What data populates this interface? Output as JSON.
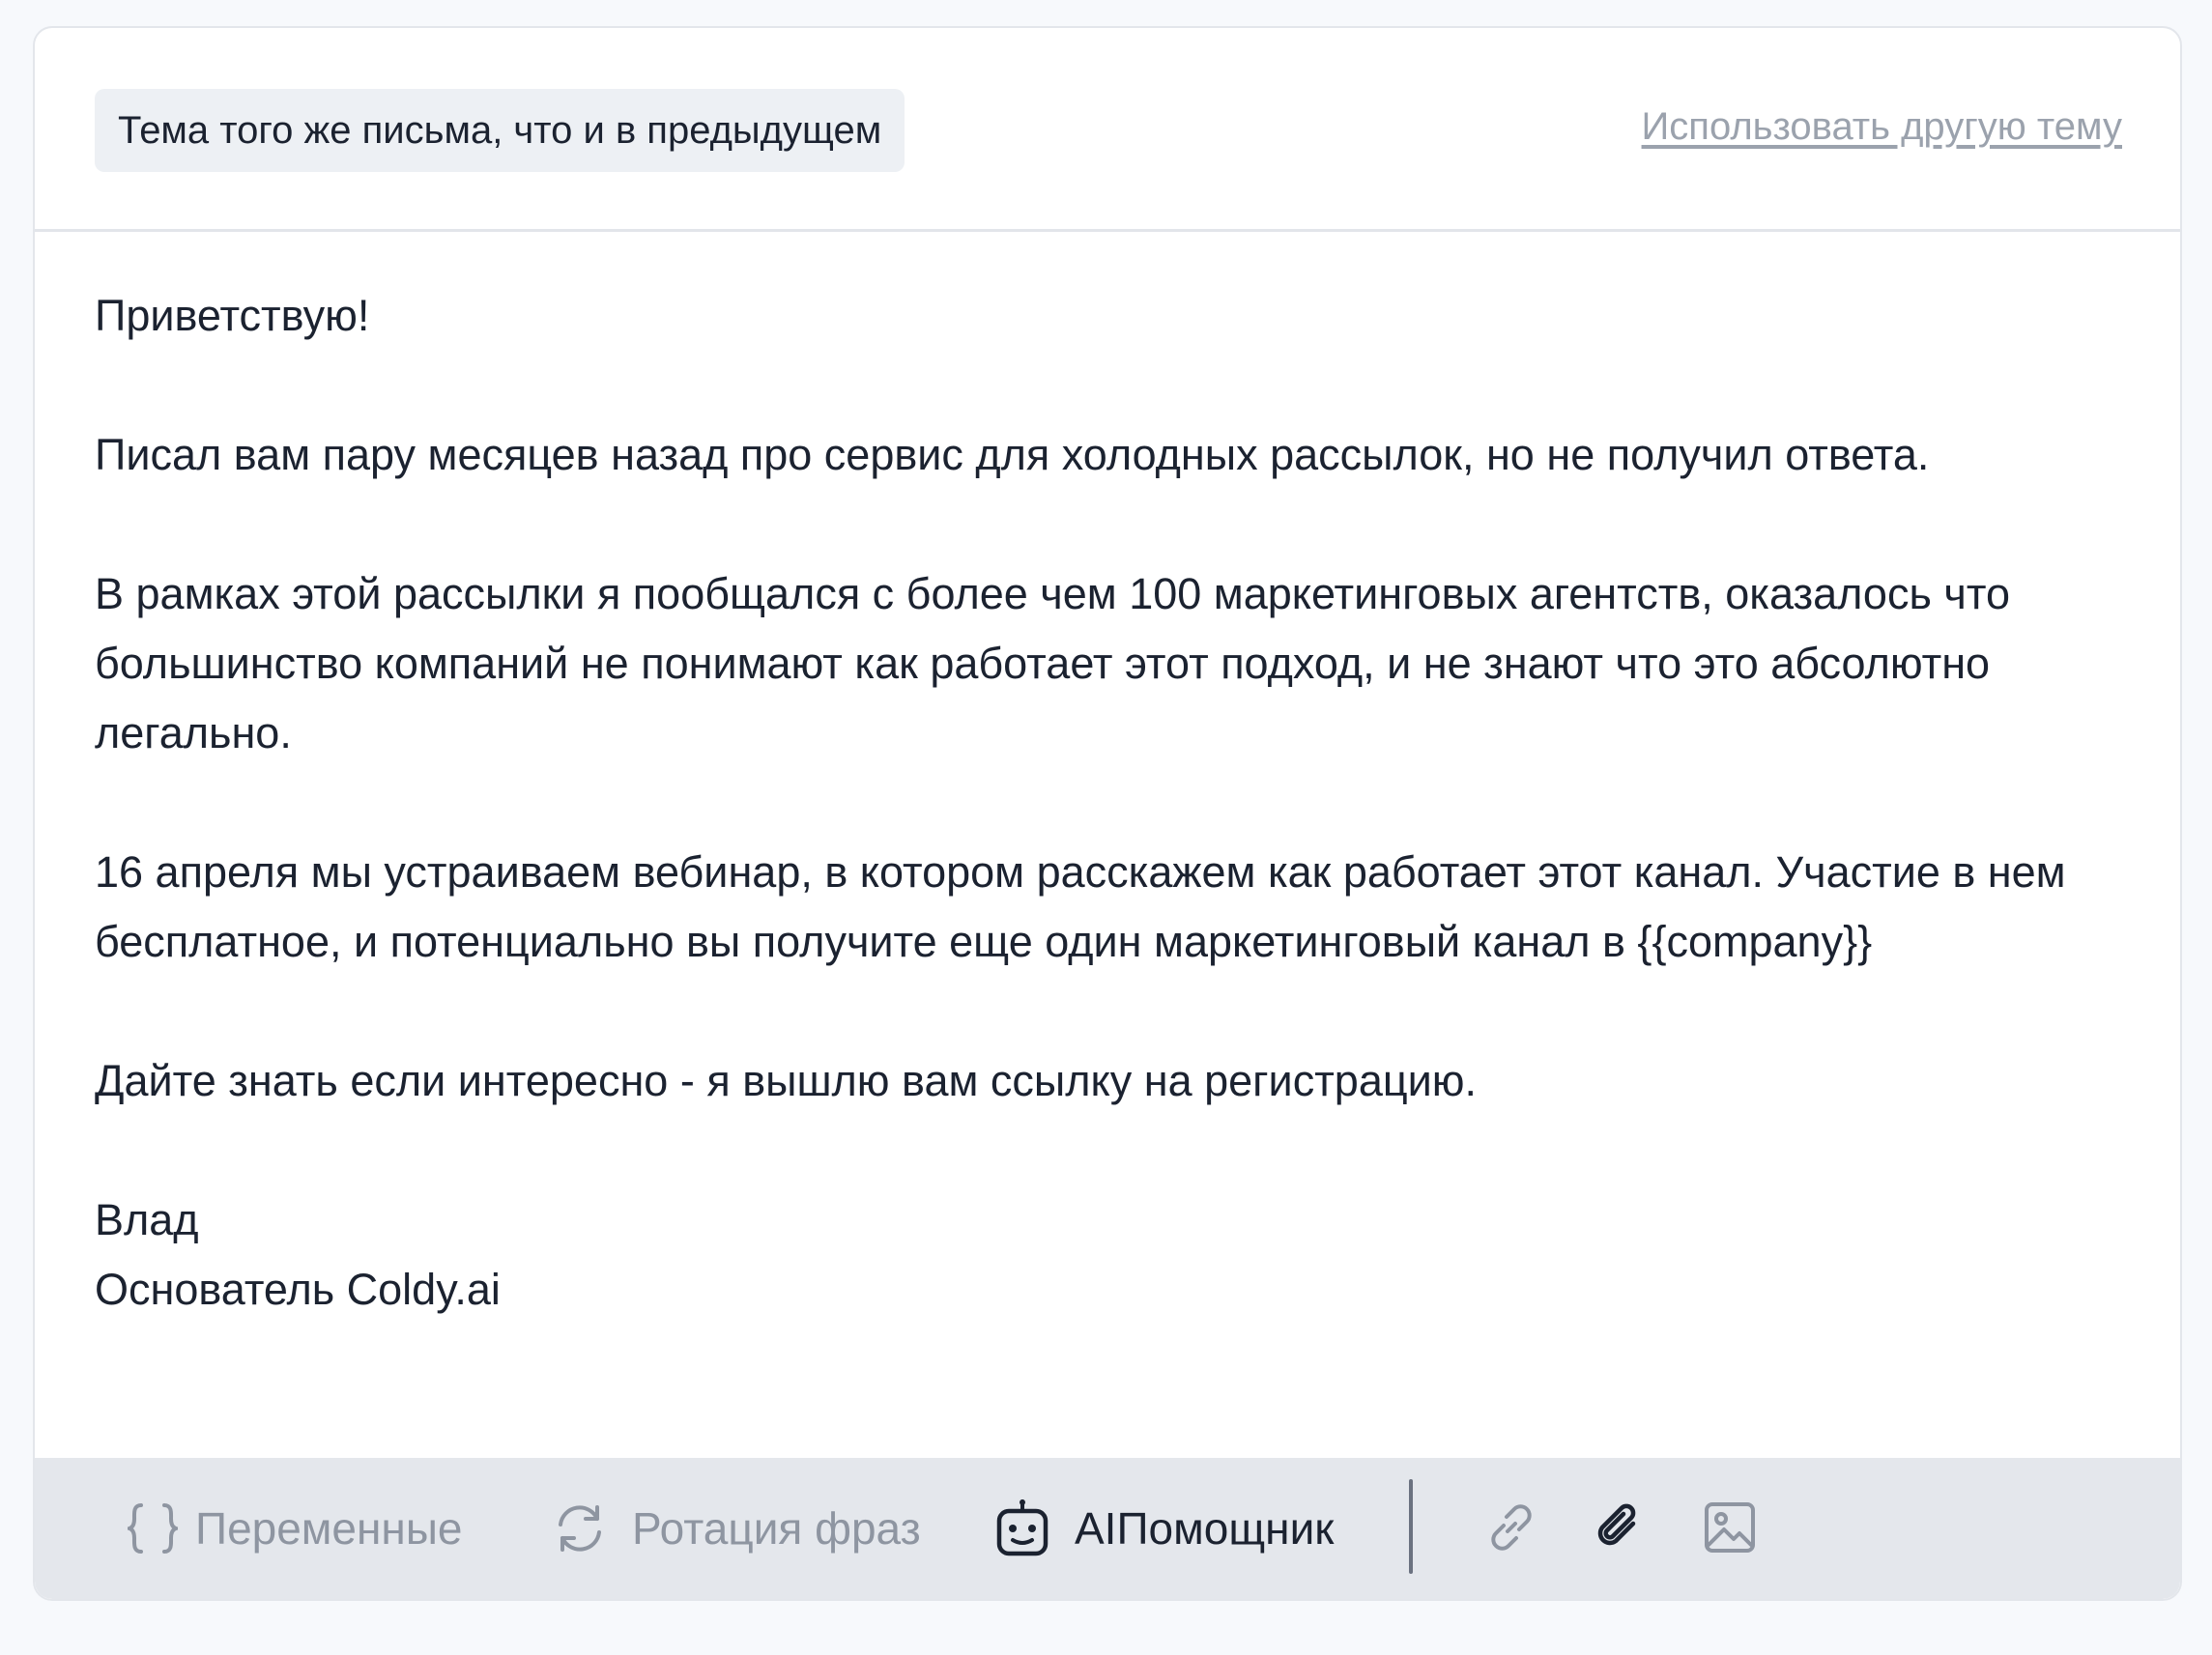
{
  "subject": {
    "chip_text": "Тема того же письма, что и в предыдущем",
    "alt_link": "Использовать другую тему"
  },
  "message": {
    "body": "Приветствую!\n\nПисал вам пару месяцев назад про сервис для холодных рассылок, но не получил ответа.\n\nВ рамках этой рассылки я пообщался с более чем 100 маркетинговых агентств, оказалось что большинство компаний не понимают как работает этот подход, и не знают что это абсолютно легально.\n\n16 апреля мы устраиваем вебинар, в котором расскажем как работает этот канал. Участие в нем бесплатное, и потенциально вы получите еще один маркетинговый канал в {{company}}\n\nДайте знать если интересно - я вышлю вам ссылку на регистрацию.\n\nВлад\nОснователь Coldy.ai"
  },
  "toolbar": {
    "variables": {
      "label": "Переменные",
      "icon": "braces-icon"
    },
    "rotation": {
      "label": "Ротация фраз",
      "icon": "rotate-icon"
    },
    "ai": {
      "label": "AIПомощник",
      "icon": "robot-icon"
    },
    "link_icon": "link-icon",
    "attach_icon": "paperclip-icon",
    "image_icon": "image-icon"
  },
  "colors": {
    "muted_text": "#8e95a1",
    "text": "#1b2230",
    "toolbar_bg": "#e4e7ec",
    "chip_bg": "#edf0f4"
  }
}
